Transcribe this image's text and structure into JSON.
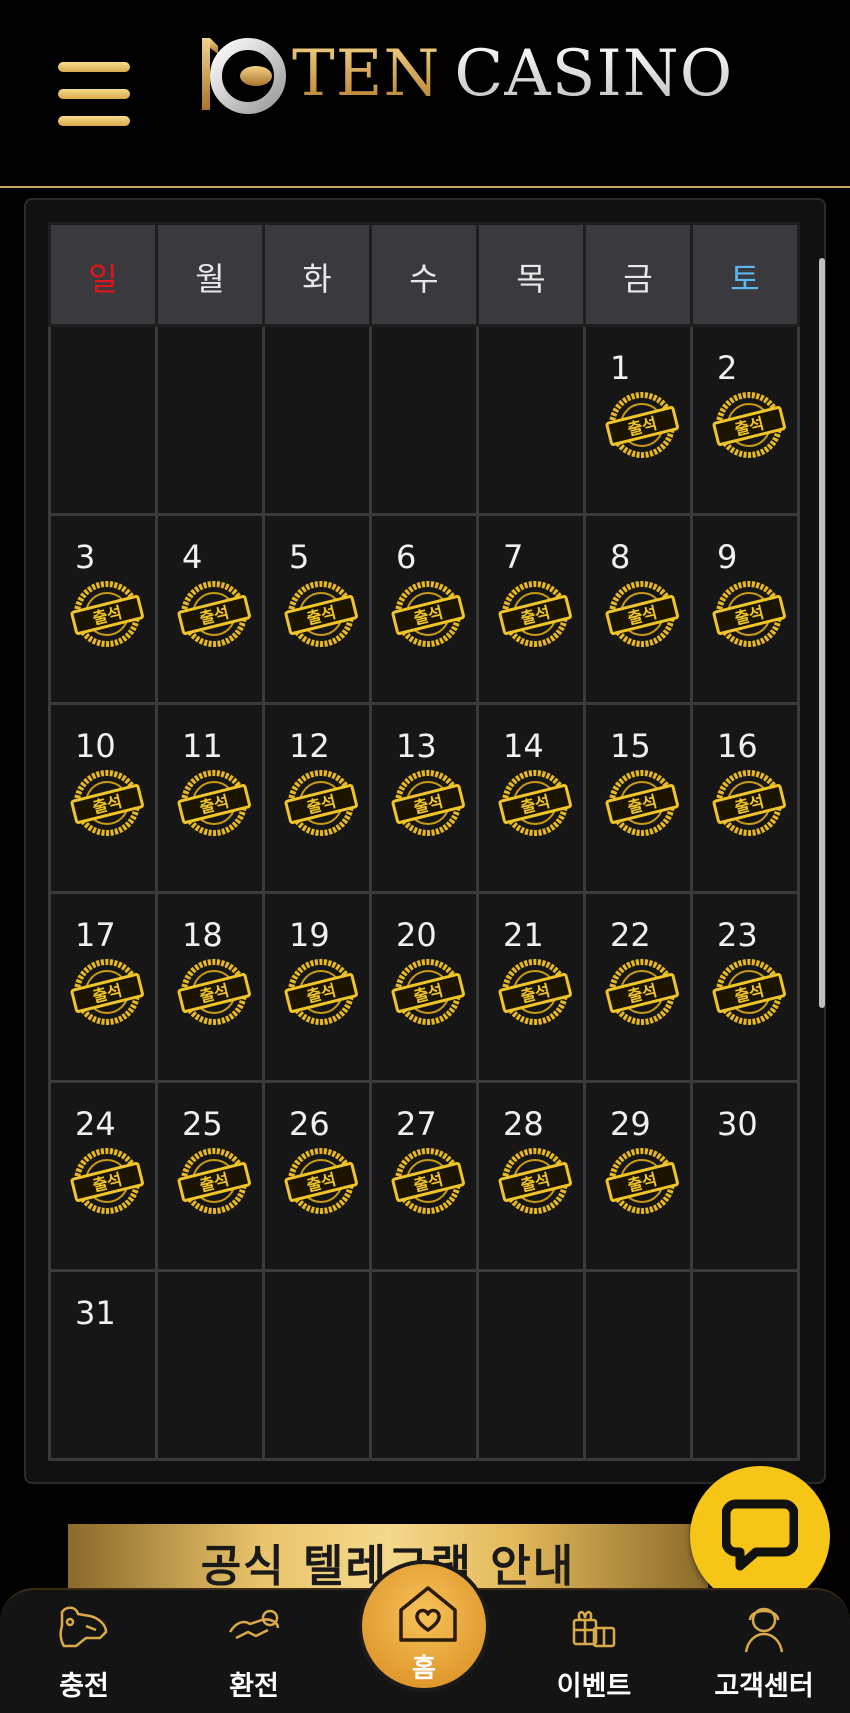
{
  "header": {
    "logo_ten": "TEN",
    "logo_casino": "CASINO"
  },
  "calendar": {
    "weekdays": [
      "일",
      "월",
      "화",
      "수",
      "목",
      "금",
      "토"
    ],
    "stamp_label": "출석",
    "weeks": [
      [
        null,
        null,
        null,
        null,
        null,
        1,
        2
      ],
      [
        3,
        4,
        5,
        6,
        7,
        8,
        9
      ],
      [
        10,
        11,
        12,
        13,
        14,
        15,
        16
      ],
      [
        17,
        18,
        19,
        20,
        21,
        22,
        23
      ],
      [
        24,
        25,
        26,
        27,
        28,
        29,
        30
      ],
      [
        31,
        null,
        null,
        null,
        null,
        null,
        null
      ]
    ],
    "attended_days": [
      1,
      2,
      3,
      4,
      5,
      6,
      7,
      8,
      9,
      10,
      11,
      12,
      13,
      14,
      15,
      16,
      17,
      18,
      19,
      20,
      21,
      22,
      23,
      24,
      25,
      26,
      27,
      28,
      29
    ]
  },
  "banner": {
    "text": "공식 텔레그램 안내"
  },
  "bottom_nav": {
    "charge": "충전",
    "exchange": "환전",
    "home": "홈",
    "event": "이벤트",
    "support": "고객센터"
  },
  "colors": {
    "sunday": "#e0151b",
    "saturday": "#5bb8f0",
    "gold": "#d9a94a",
    "chat_yellow": "#f5c518"
  }
}
